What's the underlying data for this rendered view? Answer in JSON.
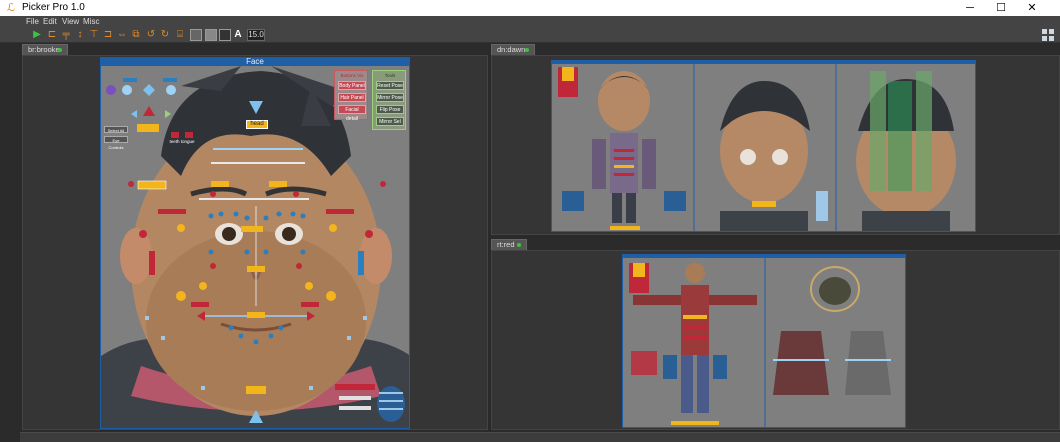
{
  "window": {
    "title": "Picker Pro 1.0",
    "minimize_glyph": "─",
    "maximize_glyph": "☐",
    "close_glyph": "✕"
  },
  "menu": [
    "File",
    "Edit",
    "View",
    "Misc"
  ],
  "toolbar": {
    "icons": [
      "play-icon",
      "align-left-icon",
      "align-top-icon",
      "align-vcenter-icon",
      "align-bottom-icon",
      "distribute-h-icon",
      "mirror-icon",
      "undo-icon",
      "redo-icon",
      "bracket-icon",
      "shape-rect-icon",
      "color-gray-icon",
      "color-dark-icon",
      "text-icon"
    ],
    "text_label": "A",
    "zoom_value": "15.0"
  },
  "panes": [
    {
      "tab": "br:brooke",
      "picker_title": "Face"
    },
    {
      "tab": "dn:dawn"
    },
    {
      "tab": "rt:red"
    }
  ],
  "face_picker": {
    "buttons_vis_title": "Buttons Vis",
    "vis_buttons": [
      "Body Panel",
      "Hair Panel",
      "Facial detail"
    ],
    "tools_title": "Tools",
    "tools_buttons": [
      "Reset Pose",
      "Mirror Pose",
      "Flip Pose",
      "Mirror Sel"
    ],
    "head_label": "head",
    "select_all": "Select All",
    "eye_controls": "Eye Controls",
    "teeth_tongue": "teeth tongue",
    "colors": {
      "accent_yellow": "#f2b51c",
      "accent_red": "#c0283a",
      "accent_blue": "#2a7fc0",
      "frame_blue": "#1f5fa8",
      "canvas_gray": "#7f7f7f"
    }
  }
}
